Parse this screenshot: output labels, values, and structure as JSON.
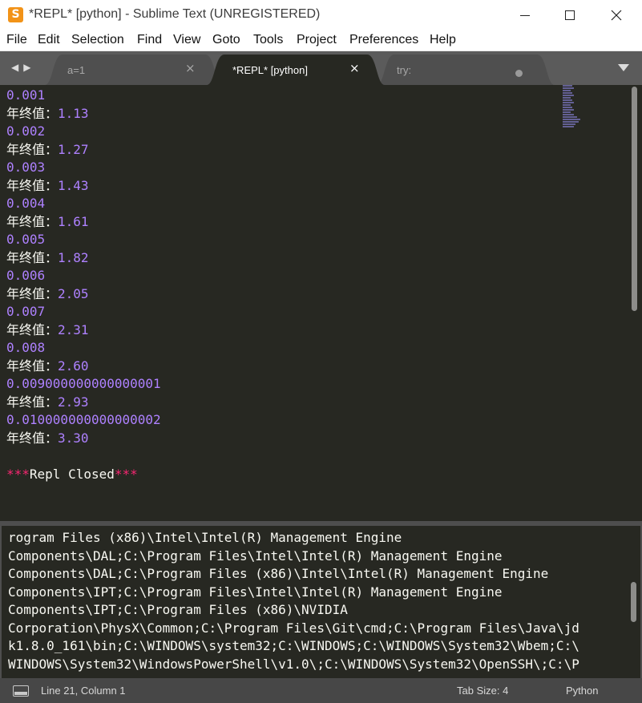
{
  "window": {
    "title": "*REPL* [python] - Sublime Text (UNREGISTERED)",
    "app_icon_letter": "S",
    "accent": "#f29318"
  },
  "menu": [
    "File",
    "Edit",
    "Selection",
    "Find",
    "View",
    "Goto",
    "Tools",
    "Project",
    "Preferences",
    "Help"
  ],
  "tabs": [
    {
      "label": "a=1",
      "close": "×",
      "active": false
    },
    {
      "label": "*REPL* [python]",
      "close": "×",
      "active": true
    },
    {
      "label": "try:",
      "dirty": true,
      "active": false
    }
  ],
  "editor": {
    "lines": [
      {
        "kind": "num",
        "text": "0.001"
      },
      {
        "kind": "val",
        "label": "年终值：",
        "value": "1.13"
      },
      {
        "kind": "num",
        "text": "0.002"
      },
      {
        "kind": "val",
        "label": "年终值：",
        "value": "1.27"
      },
      {
        "kind": "num",
        "text": "0.003"
      },
      {
        "kind": "val",
        "label": "年终值：",
        "value": "1.43"
      },
      {
        "kind": "num",
        "text": "0.004"
      },
      {
        "kind": "val",
        "label": "年终值：",
        "value": "1.61"
      },
      {
        "kind": "num",
        "text": "0.005"
      },
      {
        "kind": "val",
        "label": "年终值：",
        "value": "1.82"
      },
      {
        "kind": "num",
        "text": "0.006"
      },
      {
        "kind": "val",
        "label": "年终值：",
        "value": "2.05"
      },
      {
        "kind": "num",
        "text": "0.007"
      },
      {
        "kind": "val",
        "label": "年终值：",
        "value": "2.31"
      },
      {
        "kind": "num",
        "text": "0.008"
      },
      {
        "kind": "val",
        "label": "年终值：",
        "value": "2.60"
      },
      {
        "kind": "num",
        "text": "0.009000000000000001"
      },
      {
        "kind": "val",
        "label": "年终值：",
        "value": "2.93"
      },
      {
        "kind": "num",
        "text": "0.010000000000000002"
      },
      {
        "kind": "val",
        "label": "年终值：",
        "value": "3.30"
      },
      {
        "kind": "blank",
        "text": ""
      },
      {
        "kind": "closed",
        "stars_left": "***",
        "text": "Repl Closed",
        "stars_right": "***"
      }
    ]
  },
  "panel": {
    "lines": [
      "rogram Files (x86)\\Intel\\Intel(R) Management Engine",
      "Components\\DAL;C:\\Program Files\\Intel\\Intel(R) Management Engine",
      "Components\\DAL;C:\\Program Files (x86)\\Intel\\Intel(R) Management Engine",
      "Components\\IPT;C:\\Program Files\\Intel\\Intel(R) Management Engine",
      "Components\\IPT;C:\\Program Files (x86)\\NVIDIA",
      "Corporation\\PhysX\\Common;C:\\Program Files\\Git\\cmd;C:\\Program Files\\Java\\jd",
      "k1.8.0_161\\bin;C:\\WINDOWS\\system32;C:\\WINDOWS;C:\\WINDOWS\\System32\\Wbem;C:\\",
      "WINDOWS\\System32\\WindowsPowerShell\\v1.0\\;C:\\WINDOWS\\System32\\OpenSSH\\;C:\\P"
    ]
  },
  "status": {
    "position": "Line 21, Column 1",
    "tab_size": "Tab Size: 4",
    "syntax": "Python"
  },
  "colors": {
    "editor_bg": "#272822",
    "number": "#ae81ff",
    "keyword": "#f92672",
    "text": "#f8f8f2"
  }
}
